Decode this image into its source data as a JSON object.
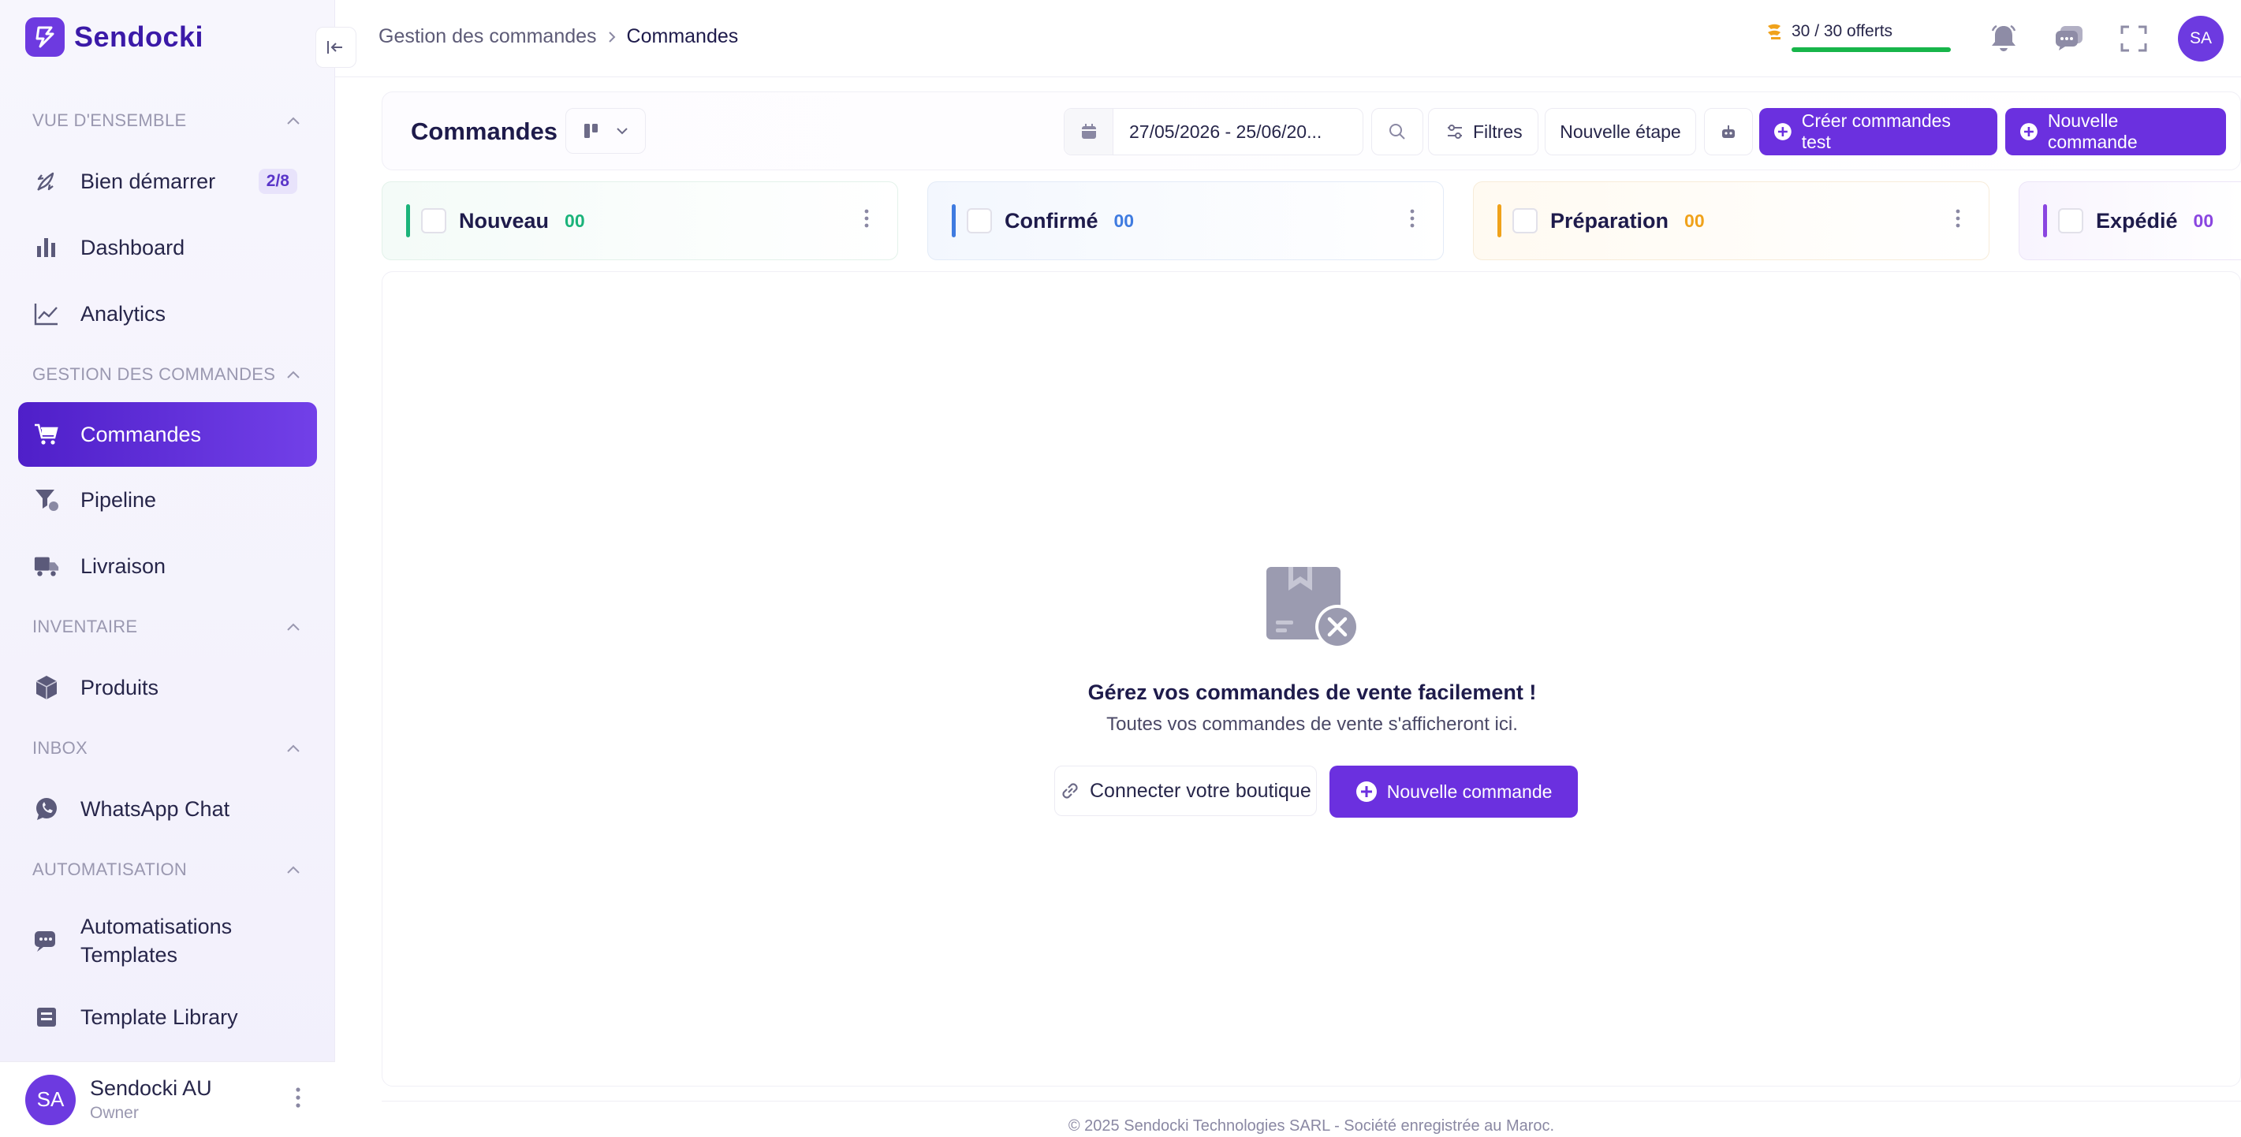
{
  "app": {
    "name": "Sendocki"
  },
  "colors": {
    "brand": "#6b30df",
    "brand_dark": "#4f1fc9",
    "nouveau": "#1bb37a",
    "confirme": "#3f7be0",
    "preparation": "#f0a21b",
    "expedie": "#8a46e0"
  },
  "sidebar": {
    "sections": [
      {
        "title": "VUE D'ENSEMBLE",
        "items": [
          {
            "label": "Bien démarrer",
            "icon": "rocket-icon",
            "badge": "2/8"
          },
          {
            "label": "Dashboard",
            "icon": "bar-chart-icon"
          },
          {
            "label": "Analytics",
            "icon": "line-chart-icon"
          }
        ]
      },
      {
        "title": "GESTION DES COMMANDES",
        "items": [
          {
            "label": "Commandes",
            "icon": "cart-icon",
            "active": true
          },
          {
            "label": "Pipeline",
            "icon": "funnel-icon"
          },
          {
            "label": "Livraison",
            "icon": "truck-icon"
          }
        ]
      },
      {
        "title": "INVENTAIRE",
        "items": [
          {
            "label": "Produits",
            "icon": "box-icon"
          }
        ]
      },
      {
        "title": "INBOX",
        "items": [
          {
            "label": "WhatsApp Chat",
            "icon": "whatsapp-icon"
          }
        ]
      },
      {
        "title": "AUTOMATISATION",
        "items": [
          {
            "label_line1": "Automatisations",
            "label_line2": "Templates",
            "icon": "chat-icon"
          },
          {
            "label": "Template Library",
            "icon": "library-icon"
          }
        ]
      }
    ],
    "user": {
      "initials": "SA",
      "name": "Sendocki AU",
      "role": "Owner"
    }
  },
  "topbar": {
    "breadcrumb": [
      "Gestion des commandes",
      "Commandes"
    ],
    "credits": "30 / 30 offerts",
    "credits_fill": 1.0,
    "avatar": "SA"
  },
  "toolbar": {
    "title": "Commandes",
    "date_range": "27/05/2026 - 25/06/20...",
    "filters": "Filtres",
    "new_stage": "Nouvelle étape",
    "create_test": "Créer commandes test",
    "new_order": "Nouvelle commande"
  },
  "columns": [
    {
      "name": "Nouveau",
      "count": "00"
    },
    {
      "name": "Confirmé",
      "count": "00"
    },
    {
      "name": "Préparation",
      "count": "00"
    },
    {
      "name": "Expédié",
      "count": "00"
    }
  ],
  "empty_state": {
    "title": "Gérez vos commandes de vente facilement !",
    "subtitle": "Toutes vos commandes de vente s'afficheront ici.",
    "connect": "Connecter votre boutique",
    "new_order": "Nouvelle commande"
  },
  "footer": "© 2025 Sendocki Technologies SARL - Société enregistrée au Maroc."
}
